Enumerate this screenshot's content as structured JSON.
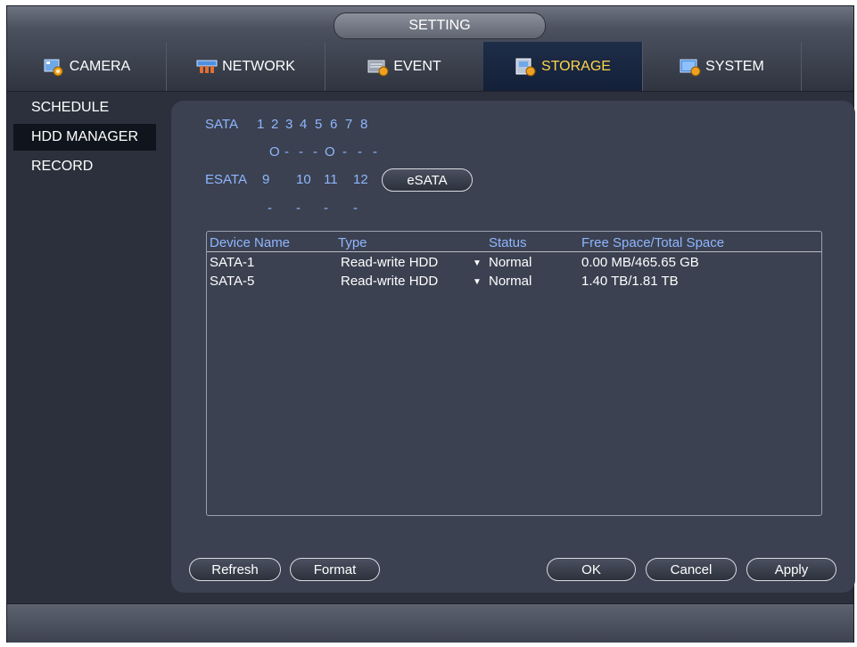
{
  "window": {
    "title": "SETTING"
  },
  "tabs": [
    {
      "label": "CAMERA",
      "icon": "camera-gear-icon"
    },
    {
      "label": "NETWORK",
      "icon": "network-icon"
    },
    {
      "label": "EVENT",
      "icon": "event-icon"
    },
    {
      "label": "STORAGE",
      "icon": "storage-icon",
      "active": true
    },
    {
      "label": "SYSTEM",
      "icon": "system-icon"
    }
  ],
  "sidebar": {
    "items": [
      {
        "label": "SCHEDULE"
      },
      {
        "label": "HDD MANAGER",
        "active": true
      },
      {
        "label": "RECORD"
      }
    ]
  },
  "sata": {
    "label": "SATA",
    "ports": [
      "1",
      "2",
      "3",
      "4",
      "5",
      "6",
      "7",
      "8"
    ],
    "states": [
      "O",
      "-",
      "-",
      "-",
      "O",
      "-",
      "-",
      "-"
    ]
  },
  "esata": {
    "label": "ESATA",
    "ports": [
      "9",
      "10",
      "11",
      "12"
    ],
    "states": [
      "-",
      "-",
      "-",
      "-"
    ],
    "button_label": "eSATA"
  },
  "table": {
    "columns": [
      "Device Name",
      "Type",
      "Status",
      "Free Space/Total Space"
    ],
    "rows": [
      {
        "device": "SATA-1",
        "type": "Read-write HDD",
        "status": "Normal",
        "space": "0.00 MB/465.65 GB"
      },
      {
        "device": "SATA-5",
        "type": "Read-write HDD",
        "status": "Normal",
        "space": "1.40 TB/1.81 TB"
      }
    ]
  },
  "buttons": {
    "refresh": "Refresh",
    "format": "Format",
    "ok": "OK",
    "cancel": "Cancel",
    "apply": "Apply"
  },
  "colors": {
    "accent_blue": "#8fb6ff",
    "active_tab_text": "#ffd54a",
    "panel_bg": "#3b4150"
  }
}
